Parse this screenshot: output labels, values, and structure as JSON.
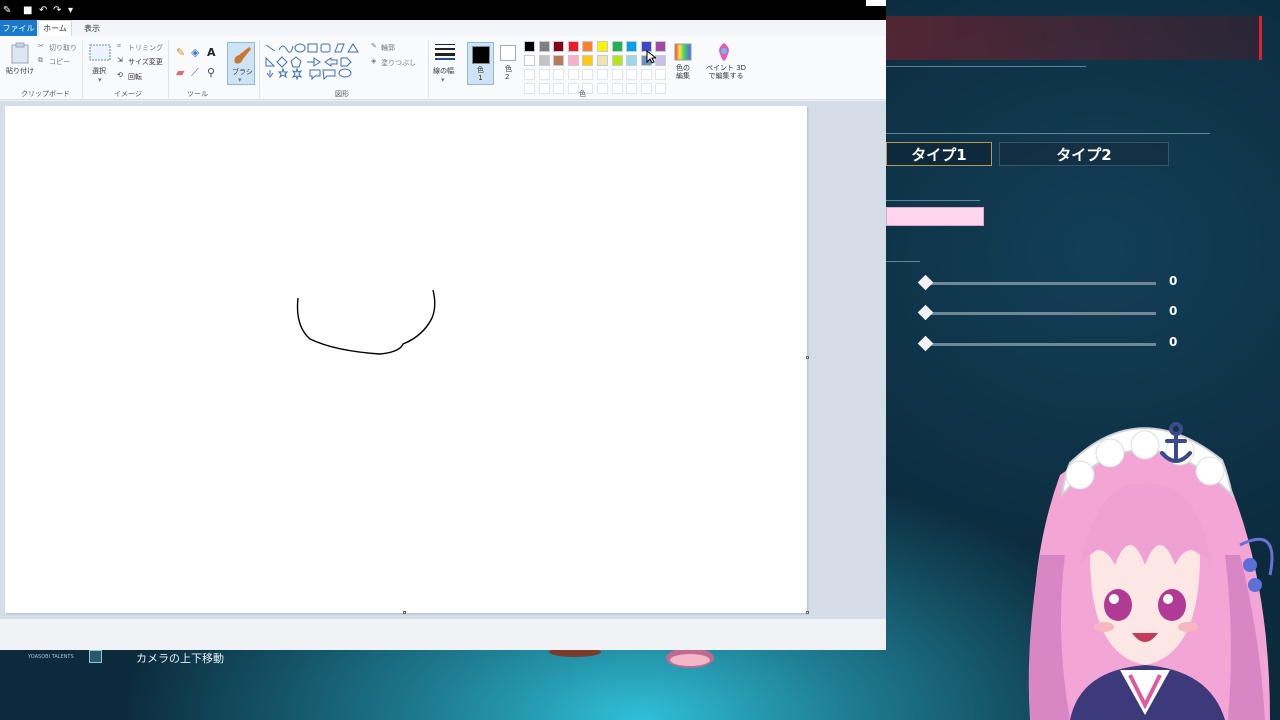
{
  "paint": {
    "menu": {
      "file": "ファイル",
      "home": "ホーム",
      "view": "表示"
    },
    "clipboard": {
      "paste": "貼り付け",
      "cut": "切り取り",
      "copy": "コピー",
      "label": "クリップボード"
    },
    "image": {
      "select": "選択",
      "crop": "トリミング",
      "resize": "サイズ変更",
      "rotate": "回転",
      "label": "イメージ"
    },
    "tools": {
      "label": "ツール",
      "brush": "ブラシ"
    },
    "shapes": {
      "outline": "輪郭",
      "fill": "塗りつぶし",
      "label": "図形"
    },
    "size": {
      "label": "線の幅"
    },
    "colors": {
      "color1": "色\n1",
      "color2": "色\n2",
      "edit": "色の\n編集",
      "paint3d": "ペイント 3D\nで編集する",
      "label": "色",
      "row1": [
        "#000000",
        "#7f7f7f",
        "#880015",
        "#ed1c24",
        "#ff7f27",
        "#fff200",
        "#22b14c",
        "#00a2e8",
        "#3f48cc",
        "#a349a4"
      ],
      "row2": [
        "#ffffff",
        "#c3c3c3",
        "#b97a57",
        "#ffaec9",
        "#ffc90e",
        "#efe4b0",
        "#b5e61d",
        "#99d9ea",
        "#7092be",
        "#c8bfe7"
      ]
    }
  },
  "game": {
    "tab1": "タイプ1",
    "tab2": "タイプ2",
    "slider_values": [
      "0",
      "0",
      "0"
    ],
    "camera_label": "カメラの上下移動",
    "logo_text": "YOASOBI TALENTS"
  }
}
